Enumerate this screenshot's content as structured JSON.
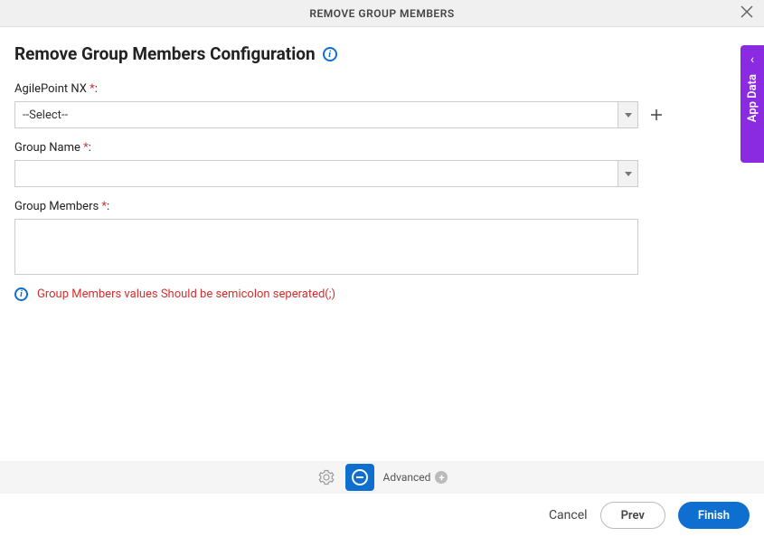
{
  "header": {
    "title": "REMOVE GROUP MEMBERS"
  },
  "page": {
    "title": "Remove Group Members Configuration"
  },
  "form": {
    "agilepoint": {
      "label": "AgilePoint NX ",
      "selected": "--Select--"
    },
    "groupName": {
      "label": "Group Name ",
      "selected": ""
    },
    "groupMembers": {
      "label": "Group Members ",
      "value": ""
    },
    "hint": "Group Members values Should be semicolon seperated(;)"
  },
  "sideTab": {
    "label": "App Data"
  },
  "footer": {
    "advanced": "Advanced"
  },
  "actions": {
    "cancel": "Cancel",
    "prev": "Prev",
    "finish": "Finish"
  }
}
